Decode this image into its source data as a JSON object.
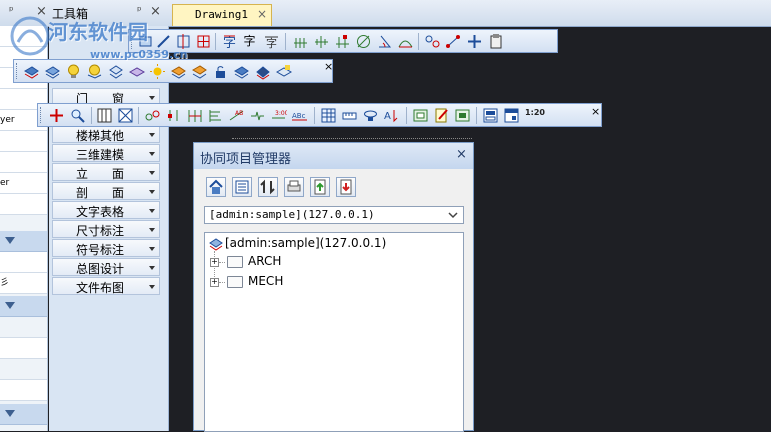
{
  "tabs": {
    "toolbox_title": "工具箱",
    "drawing_tab": "Drawing1",
    "pin": "ᵖ",
    "close": "×"
  },
  "left_panel": {
    "texts": [
      "yer",
      "er",
      "彡"
    ]
  },
  "tool_menu": {
    "items": [
      {
        "label": "门　　窗"
      },
      {
        "label": "楼梯其他"
      },
      {
        "label": "三维建模"
      },
      {
        "label": "立　　面"
      },
      {
        "label": "剖　　面"
      },
      {
        "label": "文字表格"
      },
      {
        "label": "尺寸标注"
      },
      {
        "label": "符号标注"
      },
      {
        "label": "总图设计"
      },
      {
        "label": "文件布图"
      }
    ]
  },
  "toolbar_text": {
    "text1": "字",
    "text2": "字",
    "scale": "1:20"
  },
  "dialog": {
    "title": "协同项目管理器",
    "close": "×",
    "server_select": "[admin:sample](127.0.0.1)",
    "tree_root": "[admin:sample](127.0.0.1)",
    "tree_children": [
      "ARCH",
      "MECH"
    ]
  },
  "watermark": {
    "line1": "河东软件园",
    "line2": "www.pc0359.cn"
  },
  "colors": {
    "canvas": "#1e1f24",
    "toolbar_border": "#7f9fcf",
    "accent": "#3b79c9"
  }
}
